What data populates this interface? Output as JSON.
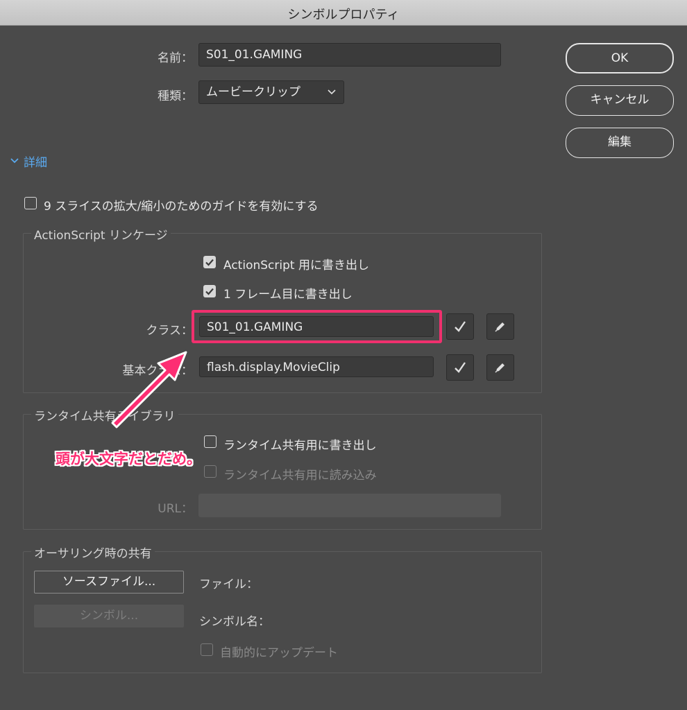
{
  "window": {
    "title": "シンボルプロパティ"
  },
  "general": {
    "name_label": "名前：",
    "name_value": "S01_01.GAMING",
    "type_label": "種類：",
    "type_value": "ムービークリップ"
  },
  "buttons": {
    "ok": "OK",
    "cancel": "キャンセル",
    "edit": "編集"
  },
  "advanced": {
    "toggle_label": "詳細"
  },
  "scale9": {
    "label": "9 スライスの拡大/縮小のためのガイドを有効にする",
    "checked": false
  },
  "linkage": {
    "title": "ActionScript リンケージ",
    "export_as": {
      "label": "ActionScript 用に書き出し",
      "checked": true
    },
    "export_frame1": {
      "label": "1 フレーム目に書き出し",
      "checked": true
    },
    "class_label": "クラス：",
    "class_value": "S01_01.GAMING",
    "base_class_label": "基本クラス：",
    "base_class_value": "flash.display.MovieClip"
  },
  "runtime": {
    "title": "ランタイム共有ライブラリ",
    "export_label": "ランタイム共有用に書き出し",
    "import_label": "ランタイム共有用に読み込み",
    "url_label": "URL："
  },
  "authoring": {
    "title": "オーサリング時の共有",
    "source_button": "ソースファイル...",
    "symbol_button": "シンボル...",
    "file_label": "ファイル：",
    "symbol_name_label": "シンボル名：",
    "auto_update_label": "自動的にアップデート"
  },
  "annotation": {
    "text": "頭が大文字だとだめ。",
    "color": "#fd2e73"
  }
}
